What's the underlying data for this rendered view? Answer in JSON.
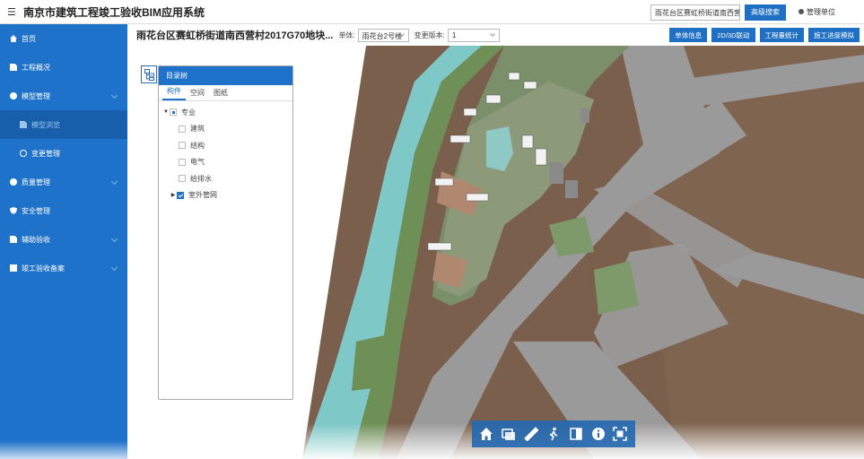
{
  "header": {
    "menu_icon": "hamburger-icon",
    "app_title": "南京市建筑工程竣工验收BIM应用系统",
    "search_value": "雨花台区赛虹桥街道南西营村",
    "advanced_search_label": "高级搜索",
    "user_icon": "user-icon",
    "user_label": "管理单位"
  },
  "sidebar": {
    "items": [
      {
        "label": "首页",
        "icon": "home-icon"
      },
      {
        "label": "工程概况",
        "icon": "document-icon"
      },
      {
        "label": "模型管理",
        "icon": "model-icon"
      },
      {
        "label": "模型浏览",
        "icon": "file-icon"
      },
      {
        "label": "变更管理",
        "icon": "change-icon"
      },
      {
        "label": "质量管理",
        "icon": "quality-icon"
      },
      {
        "label": "安全管理",
        "icon": "shield-icon"
      },
      {
        "label": "辅助验收",
        "icon": "clipboard-icon"
      },
      {
        "label": "竣工验收备案",
        "icon": "archive-icon"
      }
    ]
  },
  "toolbar": {
    "project_title": "雨花台区赛虹桥街道南西营村2017G70地块...",
    "unit_label": "单体:",
    "unit_value": "雨花台2号楼",
    "version_label": "变更版本:",
    "version_value": "1",
    "buttons": [
      "单体信息",
      "2D/3D联动",
      "工程量统计",
      "施工进度模拟"
    ]
  },
  "tree": {
    "title": "目录树",
    "tabs": [
      "构件",
      "空间",
      "图纸"
    ],
    "root": "专业",
    "children": [
      "建筑",
      "结构",
      "电气",
      "给排水"
    ],
    "sibling": "室外管网"
  },
  "map_tools": [
    "home-icon",
    "layers-icon",
    "measure-icon",
    "walk-icon",
    "section-icon",
    "info-icon",
    "fullscreen-icon"
  ],
  "colors": {
    "accent": "#1f72c9",
    "sidebar_bg": "#1f72c9",
    "ground": "#7a604c",
    "road": "#9a9a9a",
    "water": "#7fc8c8"
  }
}
